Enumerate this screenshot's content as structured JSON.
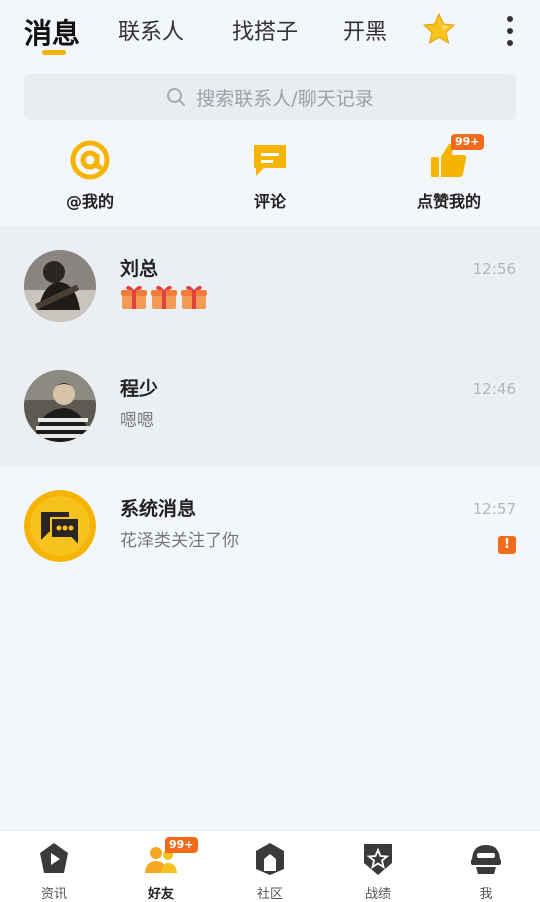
{
  "tabs": [
    {
      "label": "消息",
      "active": true
    },
    {
      "label": "联系人",
      "active": false
    },
    {
      "label": "找搭子",
      "active": false
    },
    {
      "label": "开黑",
      "active": false
    }
  ],
  "search": {
    "placeholder": "搜索联系人/聊天记录"
  },
  "quick_actions": [
    {
      "label": "@我的",
      "icon": "at-icon"
    },
    {
      "label": "评论",
      "icon": "comment-icon"
    },
    {
      "label": "点赞我的",
      "icon": "thumbs-up-icon",
      "badge": "99+"
    }
  ],
  "chats": [
    {
      "name": "刘总",
      "preview_icons": [
        "gift-icon",
        "gift-icon",
        "gift-icon"
      ],
      "time": "12:56"
    },
    {
      "name": "程少",
      "preview": "嗯嗯",
      "time": "12:46"
    },
    {
      "name": "系统消息",
      "preview": "花泽类关注了你",
      "time": "12:57",
      "alert": "!"
    }
  ],
  "bottom_nav": [
    {
      "label": "资讯",
      "icon": "news-icon"
    },
    {
      "label": "好友",
      "icon": "friends-icon",
      "badge": "99+",
      "active": true
    },
    {
      "label": "社区",
      "icon": "community-icon"
    },
    {
      "label": "战绩",
      "icon": "record-icon"
    },
    {
      "label": "我",
      "icon": "profile-icon"
    }
  ],
  "colors": {
    "accent": "#f5b400",
    "badge": "#f26b1d",
    "background": "#f3f6fa"
  }
}
